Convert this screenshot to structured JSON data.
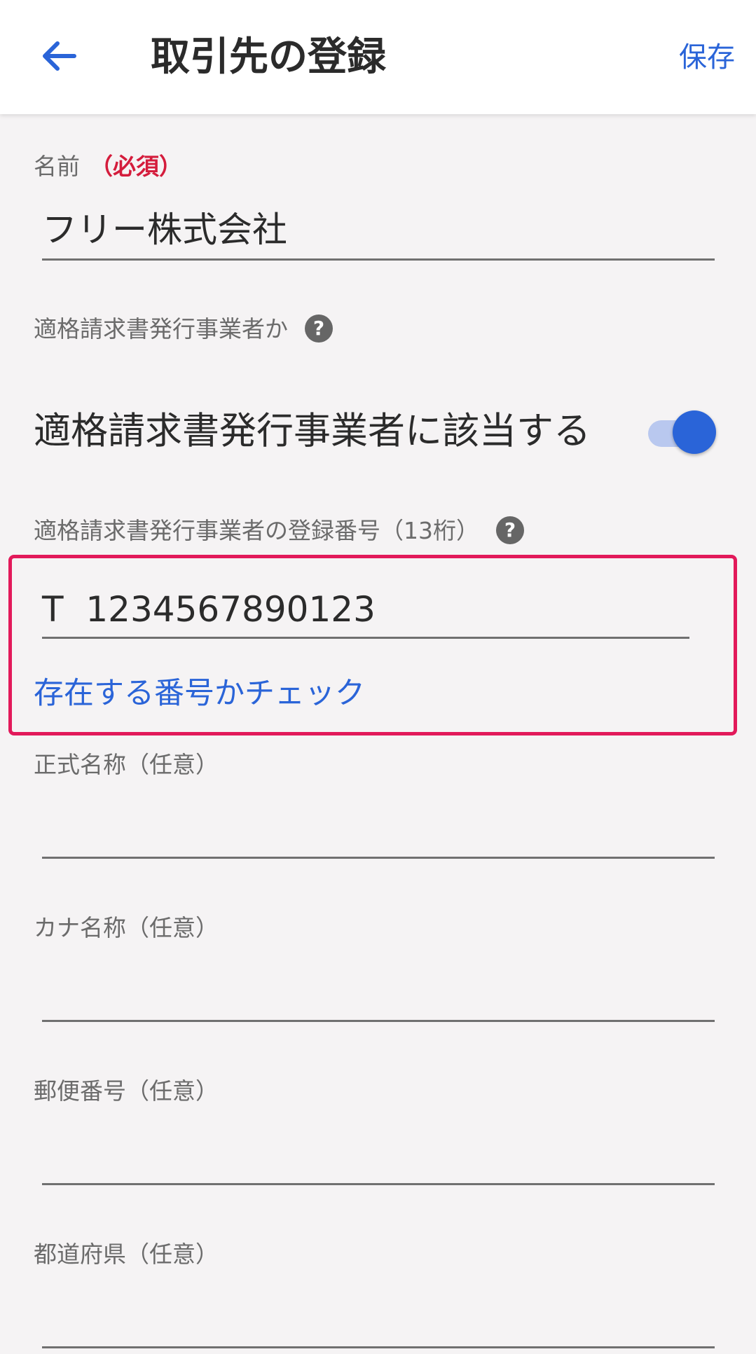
{
  "header": {
    "title": "取引先の登録",
    "save_label": "保存",
    "back_icon": "arrow-left-icon",
    "accent_color": "#2a64d8"
  },
  "form": {
    "name": {
      "label": "名前",
      "required_badge": "（必須）",
      "value": "フリー株式会社"
    },
    "qualified_issuer": {
      "section_label": "適格請求書発行事業者か",
      "toggle_label": "適格請求書発行事業者に該当する",
      "toggle_on": true
    },
    "registration_number": {
      "label": "適格請求書発行事業者の登録番号（13桁）",
      "value": "T  1234567890123",
      "check_link": "存在する番号かチェック"
    },
    "formal_name": {
      "label": "正式名称（任意）",
      "value": ""
    },
    "kana_name": {
      "label": "カナ名称（任意）",
      "value": ""
    },
    "postal_code": {
      "label": "郵便番号（任意）",
      "value": ""
    },
    "prefecture": {
      "label": "都道府県（任意）",
      "value": ""
    }
  },
  "colors": {
    "required": "#d41c3c",
    "highlight_border": "#e2195a",
    "background": "#f5f3f4"
  }
}
